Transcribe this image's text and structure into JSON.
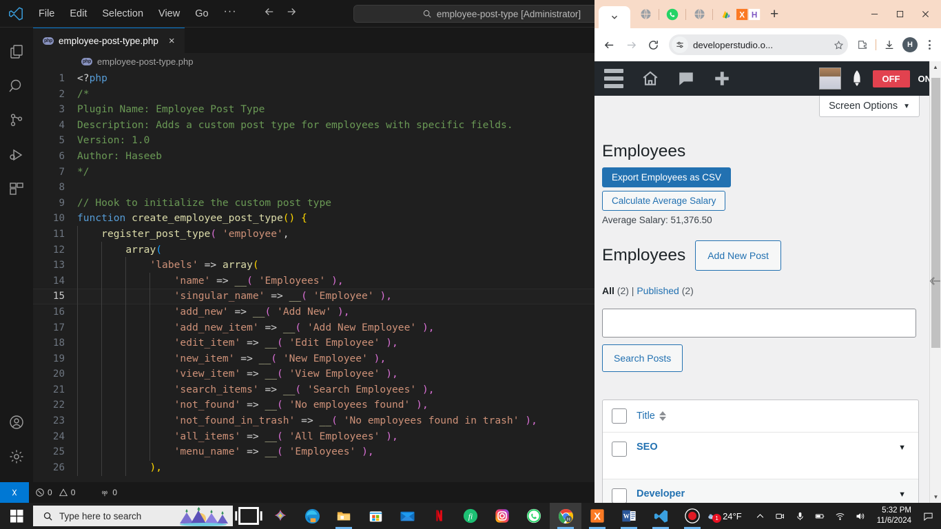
{
  "vscode": {
    "menu": [
      "File",
      "Edit",
      "Selection",
      "View",
      "Go",
      "···"
    ],
    "search_placeholder": "employee-post-type [Administrator]",
    "tab": {
      "label": "employee-post-type.php",
      "close": "×"
    },
    "breadcrumb": "employee-post-type.php",
    "activity_icons": [
      "explorer-icon",
      "search-icon",
      "source-control-icon",
      "run-debug-icon",
      "extensions-icon",
      "account-icon",
      "settings-gear-icon"
    ],
    "status": {
      "errors": "0",
      "warnings": "0",
      "ports": "0"
    },
    "code": {
      "language": "php",
      "active_line": 15,
      "lines": [
        {
          "n": 1,
          "html": "<span class=\"c-op\">&lt;?</span><span class=\"c-kw\">php</span>"
        },
        {
          "n": 2,
          "html": "<span class=\"c-cm\">/*</span>"
        },
        {
          "n": 3,
          "html": "<span class=\"c-cm\">Plugin Name: Employee Post Type</span>"
        },
        {
          "n": 4,
          "html": "<span class=\"c-cm\">Description: Adds a custom post type for employees with specific fields.</span>"
        },
        {
          "n": 5,
          "html": "<span class=\"c-cm\">Version: 1.0</span>"
        },
        {
          "n": 6,
          "html": "<span class=\"c-cm\">Author: Haseeb</span>"
        },
        {
          "n": 7,
          "html": "<span class=\"c-cm\">*/</span>"
        },
        {
          "n": 8,
          "html": ""
        },
        {
          "n": 9,
          "html": "<span class=\"c-cm\">// Hook to initialize the custom post type</span>"
        },
        {
          "n": 10,
          "html": "<span class=\"c-kw\">function</span> <span class=\"c-fn\">create_employee_post_type</span><span class=\"c-p1\">()</span> <span class=\"c-p1\">{</span>"
        },
        {
          "n": 11,
          "html": "<span class=\"ind\">    </span><span class=\"c-fn\">register_post_type</span><span class=\"c-p2\">(</span> <span class=\"c-str\">'employee'</span><span class=\"c-white\">,</span>"
        },
        {
          "n": 12,
          "html": "<span class=\"ind\">    </span><span class=\"ind\">    </span><span class=\"c-fn\">array</span><span class=\"c-p3\">(</span>"
        },
        {
          "n": 13,
          "html": "<span class=\"ind\">    </span><span class=\"ind\">    </span><span class=\"ind\">    </span><span class=\"c-str\">'labels'</span> <span class=\"c-op\">=&gt;</span> <span class=\"c-fn\">array</span><span class=\"c-p1\">(</span>"
        },
        {
          "n": 14,
          "html": "<span class=\"ind\">    </span><span class=\"ind\">    </span><span class=\"ind\">    </span><span class=\"ind\">    </span><span class=\"c-str\">'name'</span> <span class=\"c-op\">=&gt;</span> <span class=\"c-fn\">__</span><span class=\"c-p2\">(</span> <span class=\"c-str\">'Employees'</span> <span class=\"c-p2\">),</span>"
        },
        {
          "n": 15,
          "html": "<span class=\"ind\">    </span><span class=\"ind\">    </span><span class=\"ind\">    </span><span class=\"ind\">    </span><span class=\"c-str\">'singular_name'</span> <span class=\"c-op\">=&gt;</span> <span class=\"c-fn\">__</span><span class=\"c-p2\">(</span> <span class=\"c-str\">'Employee'</span> <span class=\"c-p2\">),</span>"
        },
        {
          "n": 16,
          "html": "<span class=\"ind\">    </span><span class=\"ind\">    </span><span class=\"ind\">    </span><span class=\"ind\">    </span><span class=\"c-str\">'add_new'</span> <span class=\"c-op\">=&gt;</span> <span class=\"c-fn\">__</span><span class=\"c-p2\">(</span> <span class=\"c-str\">'Add New'</span> <span class=\"c-p2\">),</span>"
        },
        {
          "n": 17,
          "html": "<span class=\"ind\">    </span><span class=\"ind\">    </span><span class=\"ind\">    </span><span class=\"ind\">    </span><span class=\"c-str\">'add_new_item'</span> <span class=\"c-op\">=&gt;</span> <span class=\"c-fn\">__</span><span class=\"c-p2\">(</span> <span class=\"c-str\">'Add New Employee'</span> <span class=\"c-p2\">),</span>"
        },
        {
          "n": 18,
          "html": "<span class=\"ind\">    </span><span class=\"ind\">    </span><span class=\"ind\">    </span><span class=\"ind\">    </span><span class=\"c-str\">'edit_item'</span> <span class=\"c-op\">=&gt;</span> <span class=\"c-fn\">__</span><span class=\"c-p2\">(</span> <span class=\"c-str\">'Edit Employee'</span> <span class=\"c-p2\">),</span>"
        },
        {
          "n": 19,
          "html": "<span class=\"ind\">    </span><span class=\"ind\">    </span><span class=\"ind\">    </span><span class=\"ind\">    </span><span class=\"c-str\">'new_item'</span> <span class=\"c-op\">=&gt;</span> <span class=\"c-fn\">__</span><span class=\"c-p2\">(</span> <span class=\"c-str\">'New Employee'</span> <span class=\"c-p2\">),</span>"
        },
        {
          "n": 20,
          "html": "<span class=\"ind\">    </span><span class=\"ind\">    </span><span class=\"ind\">    </span><span class=\"ind\">    </span><span class=\"c-str\">'view_item'</span> <span class=\"c-op\">=&gt;</span> <span class=\"c-fn\">__</span><span class=\"c-p2\">(</span> <span class=\"c-str\">'View Employee'</span> <span class=\"c-p2\">),</span>"
        },
        {
          "n": 21,
          "html": "<span class=\"ind\">    </span><span class=\"ind\">    </span><span class=\"ind\">    </span><span class=\"ind\">    </span><span class=\"c-str\">'search_items'</span> <span class=\"c-op\">=&gt;</span> <span class=\"c-fn\">__</span><span class=\"c-p2\">(</span> <span class=\"c-str\">'Search Employees'</span> <span class=\"c-p2\">),</span>"
        },
        {
          "n": 22,
          "html": "<span class=\"ind\">    </span><span class=\"ind\">    </span><span class=\"ind\">    </span><span class=\"ind\">    </span><span class=\"c-str\">'not_found'</span> <span class=\"c-op\">=&gt;</span> <span class=\"c-fn\">__</span><span class=\"c-p2\">(</span> <span class=\"c-str\">'No employees found'</span> <span class=\"c-p2\">),</span>"
        },
        {
          "n": 23,
          "html": "<span class=\"ind\">    </span><span class=\"ind\">    </span><span class=\"ind\">    </span><span class=\"ind\">    </span><span class=\"c-str\">'not_found_in_trash'</span> <span class=\"c-op\">=&gt;</span> <span class=\"c-fn\">__</span><span class=\"c-p2\">(</span> <span class=\"c-str\">'No employees found in trash'</span> <span class=\"c-p2\">),</span>"
        },
        {
          "n": 24,
          "html": "<span class=\"ind\">    </span><span class=\"ind\">    </span><span class=\"ind\">    </span><span class=\"ind\">    </span><span class=\"c-str\">'all_items'</span> <span class=\"c-op\">=&gt;</span> <span class=\"c-fn\">__</span><span class=\"c-p2\">(</span> <span class=\"c-str\">'All Employees'</span> <span class=\"c-p2\">),</span>"
        },
        {
          "n": 25,
          "html": "<span class=\"ind\">    </span><span class=\"ind\">    </span><span class=\"ind\">    </span><span class=\"ind\">    </span><span class=\"c-str\">'menu_name'</span> <span class=\"c-op\">=&gt;</span> <span class=\"c-fn\">__</span><span class=\"c-p2\">(</span> <span class=\"c-str\">'Employees'</span> <span class=\"c-p2\">),</span>"
        },
        {
          "n": 26,
          "html": "<span class=\"ind\">    </span><span class=\"ind\">    </span><span class=\"ind\">    </span><span class=\"c-p1\">),</span>"
        }
      ]
    }
  },
  "browser": {
    "tabs": [
      {
        "name": "tab-dropdown",
        "icon": "chevron-down-icon"
      },
      {
        "name": "favicon-globe-1",
        "icon": "globe-icon"
      },
      {
        "name": "favicon-whatsapp",
        "icon": "whatsapp-icon"
      },
      {
        "name": "favicon-globe-2",
        "icon": "globe-icon"
      },
      {
        "name": "favicon-adsense",
        "icon": "adsense-icon"
      },
      {
        "name": "favicon-xampp",
        "icon": "xampp-icon"
      }
    ],
    "new_tab_label": "+",
    "window_controls": {
      "minimize": "–",
      "maximize": "□",
      "close": "✕"
    },
    "toolbar": {
      "back": "back-arrow-icon",
      "forward": "forward-arrow-icon",
      "reload": "reload-icon",
      "url": "developerstudio.o...",
      "bookmark": "star-icon",
      "extensions": "puzzle-icon",
      "downloads": "download-icon",
      "profile_initial": "H",
      "menu": "kebab-menu-icon"
    }
  },
  "wordpress": {
    "adminbar": {
      "menu_icon": "hamburger-icon",
      "home_icon": "home-icon",
      "comments_icon": "comment-bubble-icon",
      "new_icon": "plus-icon",
      "avatar": "user-avatar",
      "rocket_icon": "rocket-icon",
      "toggle_off": "OFF",
      "toggle_on": "ON"
    },
    "screen_options": {
      "label": "Screen Options",
      "caret": "▼"
    },
    "page_title": "Employees",
    "export_button": "Export Employees as CSV",
    "calculate_button": "Calculate Average Salary",
    "average_salary": "Average Salary: 51,376.50",
    "list_title": "Employees",
    "add_new_button": "Add New Post",
    "filters": {
      "all_label": "All",
      "all_count": "(2)",
      "separator": "|",
      "published_label": "Published",
      "published_count": "(2)"
    },
    "search": {
      "value": "",
      "placeholder": "",
      "button": "Search Posts"
    },
    "table": {
      "columns": [
        "Title"
      ],
      "rows": [
        {
          "title": "SEO",
          "caret": "▼"
        },
        {
          "title": "Developer",
          "caret": "▼"
        }
      ]
    }
  },
  "taskbar": {
    "start_icon": "windows-start-icon",
    "search_placeholder": "Type here to search",
    "task_view_icon": "task-view-icon",
    "apps": [
      {
        "name": "copilot-icon"
      },
      {
        "name": "edge-icon"
      },
      {
        "name": "file-explorer-icon"
      },
      {
        "name": "microsoft-store-icon"
      },
      {
        "name": "mail-icon"
      },
      {
        "name": "netflix-icon"
      },
      {
        "name": "fiverr-icon"
      },
      {
        "name": "instagram-icon"
      },
      {
        "name": "whatsapp-icon"
      },
      {
        "name": "chrome-icon"
      },
      {
        "name": "xampp-icon"
      },
      {
        "name": "word-icon"
      },
      {
        "name": "vscode-icon"
      },
      {
        "name": "recorder-icon"
      }
    ],
    "tray": {
      "weather_temp": "24°F",
      "weather_badge": "1",
      "chevron": "show-hidden-icons",
      "time": "5:32 PM",
      "date": "11/6/2024",
      "notifications_icon": "notification-icon"
    }
  },
  "colors": {
    "vscode_bg": "#1f1f1f",
    "vscode_titlebar": "#181818",
    "accent_blue": "#0078d4",
    "browser_tabstrip": "#f8dbc8",
    "wp_adminbar": "#23282d",
    "wp_content_bg": "#f0f0f1",
    "wp_primary": "#2271b1",
    "wp_toggle_off": "#e2424f"
  }
}
